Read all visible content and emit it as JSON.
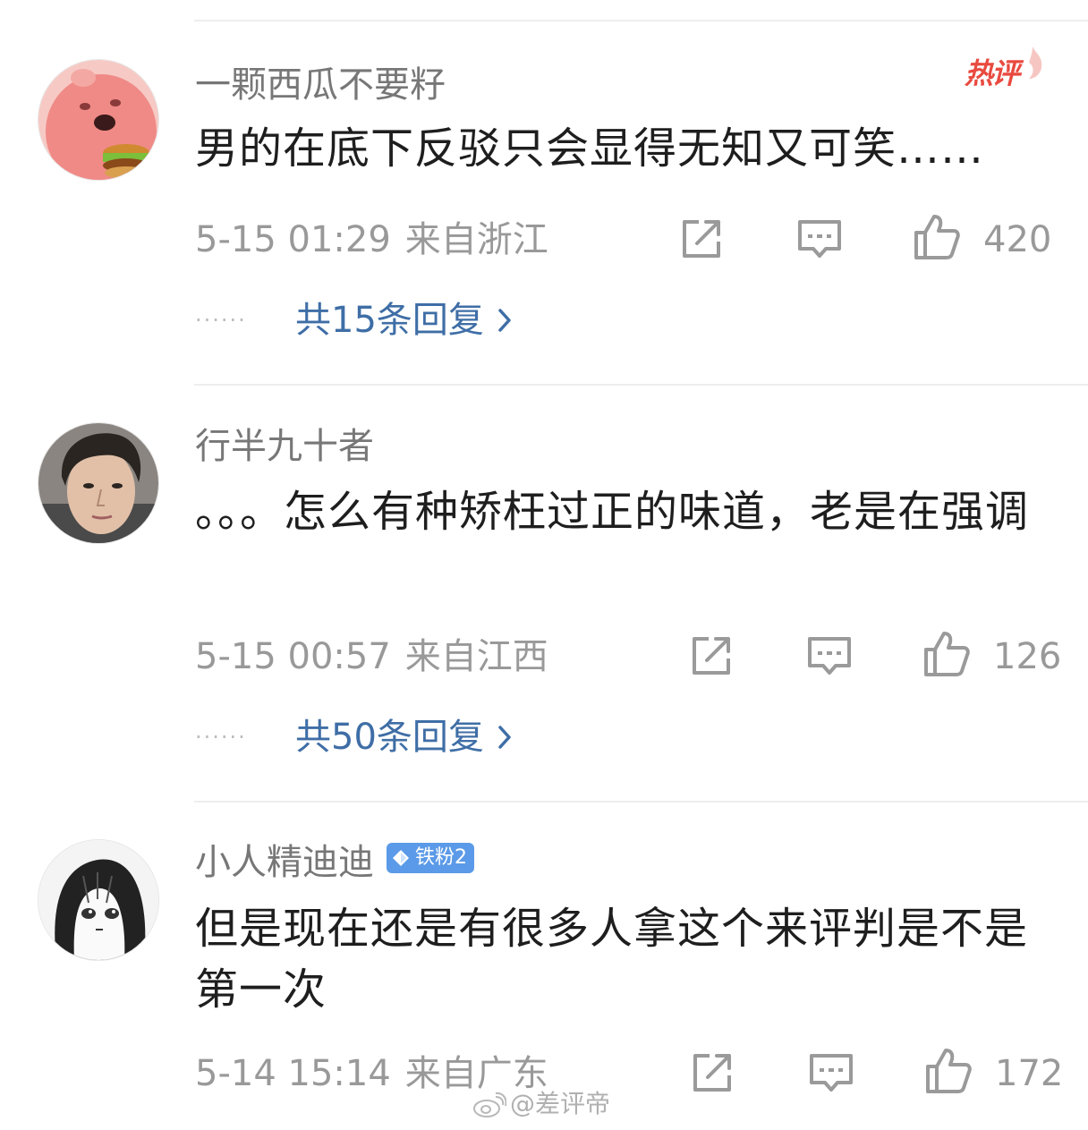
{
  "comments": [
    {
      "username": "一颗西瓜不要籽",
      "hot_label": "热评",
      "text": "男的在底下反驳只会显得无知又可笑……",
      "time": "5-15 01:29",
      "location": "来自浙江",
      "likes": "420",
      "replies": "共15条回复",
      "avatar_icon": "pink-cartoon-avatar"
    },
    {
      "username": "行半九十者",
      "text": "。。。怎么有种矫枉过正的味道，老是在强调",
      "time": "5-15 00:57",
      "location": "来自江西",
      "likes": "126",
      "replies": "共50条回复",
      "avatar_icon": "portrait-avatar"
    },
    {
      "username": "小人精迪迪",
      "badge": "铁粉2",
      "text": "但是现在还是有很多人拿这个来评判是不是第一次",
      "time": "5-14 15:14",
      "location": "来自广东",
      "likes": "172",
      "avatar_icon": "manga-girl-avatar"
    }
  ],
  "watermark": "@差评帝",
  "colors": {
    "reply_link": "#3f6ea6",
    "hot_tag": "#e94a3f",
    "badge": "#5b9ae8",
    "meta_text": "#999999"
  }
}
